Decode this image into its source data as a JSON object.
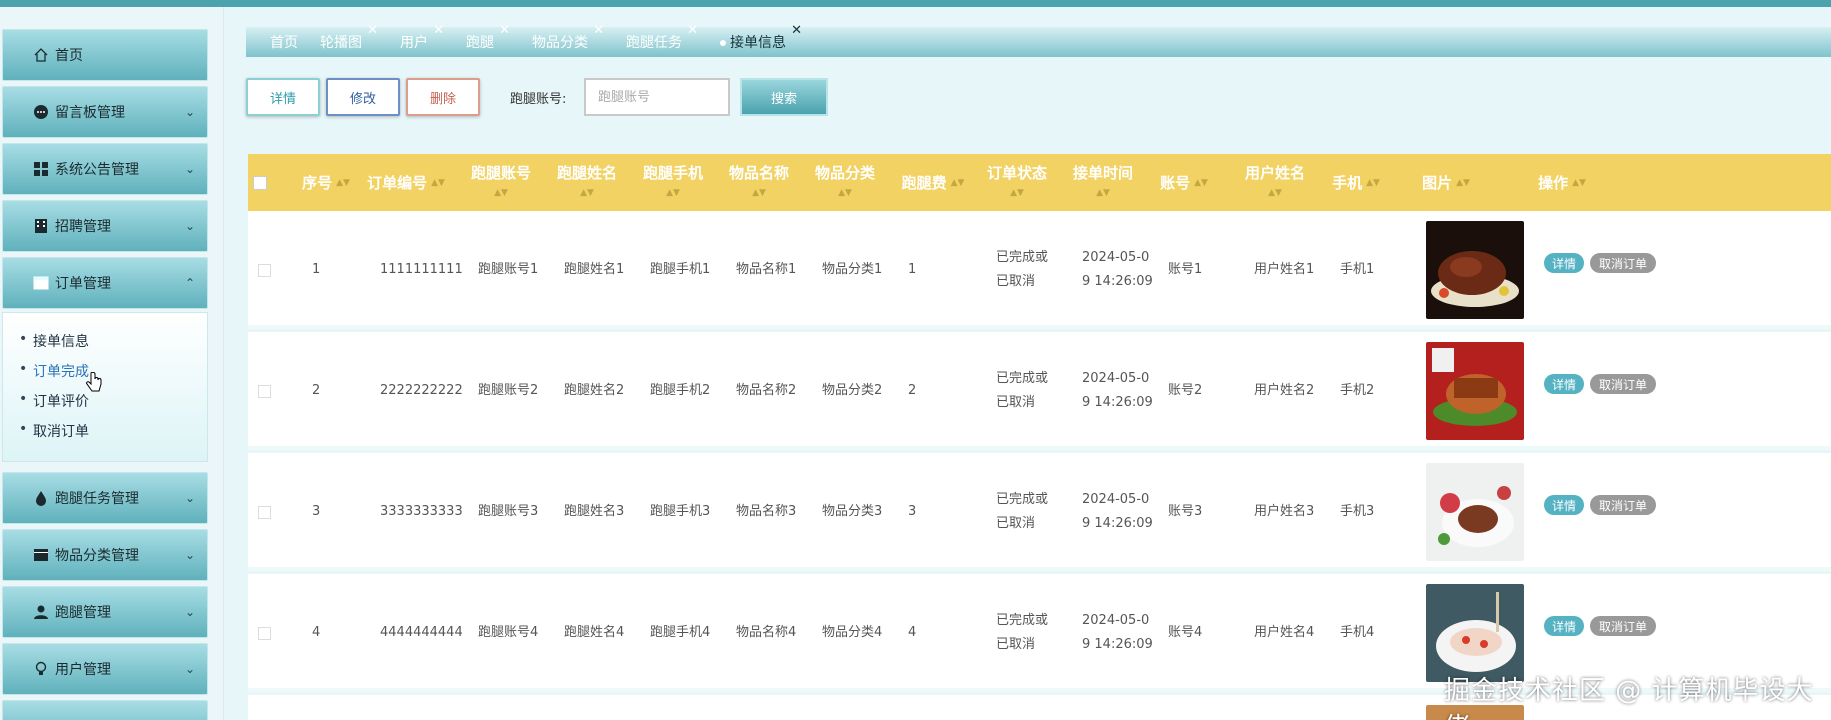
{
  "sidebar": {
    "items": [
      {
        "label": "首页",
        "icon": "home-icon"
      },
      {
        "label": "留言板管理",
        "icon": "message-icon"
      },
      {
        "label": "系统公告管理",
        "icon": "grid-icon"
      },
      {
        "label": "招聘管理",
        "icon": "building-icon"
      },
      {
        "label": "订单管理",
        "icon": "card-icon"
      },
      {
        "label": "跑腿任务管理",
        "icon": "drop-icon"
      },
      {
        "label": "物品分类管理",
        "icon": "card-icon"
      },
      {
        "label": "跑腿管理",
        "icon": "user-icon"
      },
      {
        "label": "用户管理",
        "icon": "bulb-icon"
      }
    ],
    "submenu": [
      "接单信息",
      "订单完成",
      "订单评价",
      "取消订单"
    ]
  },
  "tabs": [
    {
      "label": "首页"
    },
    {
      "label": "轮播图"
    },
    {
      "label": "用户"
    },
    {
      "label": "跑腿"
    },
    {
      "label": "物品分类"
    },
    {
      "label": "跑腿任务"
    },
    {
      "label": "接单信息"
    }
  ],
  "toolbar": {
    "detail_label": "详情",
    "edit_label": "修改",
    "delete_label": "删除",
    "search_label": "跑腿账号:",
    "search_placeholder": "跑腿账号",
    "search_button": "搜索"
  },
  "table": {
    "headers": [
      "序号",
      "订单编号",
      "跑腿账号",
      "跑腿姓名",
      "跑腿手机",
      "物品名称",
      "物品分类",
      "跑腿费",
      "订单状态",
      "接单时间",
      "账号",
      "用户姓名",
      "手机",
      "图片",
      "操作"
    ],
    "rows": [
      {
        "idx": "1",
        "order_no": "1111111111",
        "runner_account": "跑腿账号1",
        "runner_name": "跑腿姓名1",
        "runner_phone": "跑腿手机1",
        "item_name": "物品名称1",
        "item_category": "物品分类1",
        "fee": "1",
        "status_line1": "已完成或",
        "status_line2": "已取消",
        "time_line1": "2024-05-0",
        "time_line2": "9 14:26:09",
        "account": "账号1",
        "user_name": "用户姓名1",
        "phone": "手机1"
      },
      {
        "idx": "2",
        "order_no": "2222222222",
        "runner_account": "跑腿账号2",
        "runner_name": "跑腿姓名2",
        "runner_phone": "跑腿手机2",
        "item_name": "物品名称2",
        "item_category": "物品分类2",
        "fee": "2",
        "status_line1": "已完成或",
        "status_line2": "已取消",
        "time_line1": "2024-05-0",
        "time_line2": "9 14:26:09",
        "account": "账号2",
        "user_name": "用户姓名2",
        "phone": "手机2"
      },
      {
        "idx": "3",
        "order_no": "3333333333",
        "runner_account": "跑腿账号3",
        "runner_name": "跑腿姓名3",
        "runner_phone": "跑腿手机3",
        "item_name": "物品名称3",
        "item_category": "物品分类3",
        "fee": "3",
        "status_line1": "已完成或",
        "status_line2": "已取消",
        "time_line1": "2024-05-0",
        "time_line2": "9 14:26:09",
        "account": "账号3",
        "user_name": "用户姓名3",
        "phone": "手机3"
      },
      {
        "idx": "4",
        "order_no": "4444444444",
        "runner_account": "跑腿账号4",
        "runner_name": "跑腿姓名4",
        "runner_phone": "跑腿手机4",
        "item_name": "物品名称4",
        "item_category": "物品分类4",
        "fee": "4",
        "status_line1": "已完成或",
        "status_line2": "已取消",
        "time_line1": "2024-05-0",
        "time_line2": "9 14:26:09",
        "account": "账号4",
        "user_name": "用户姓名4",
        "phone": "手机4"
      }
    ],
    "actions": {
      "detail": "详情",
      "cancel": "取消订单"
    }
  },
  "watermark": "掘金技术社区 @ 计算机毕设大佬",
  "colors": {
    "accent": "#4aa3ad",
    "header": "#f2d263",
    "detail_pill": "#55b2c2",
    "cancel_pill": "#999999"
  }
}
